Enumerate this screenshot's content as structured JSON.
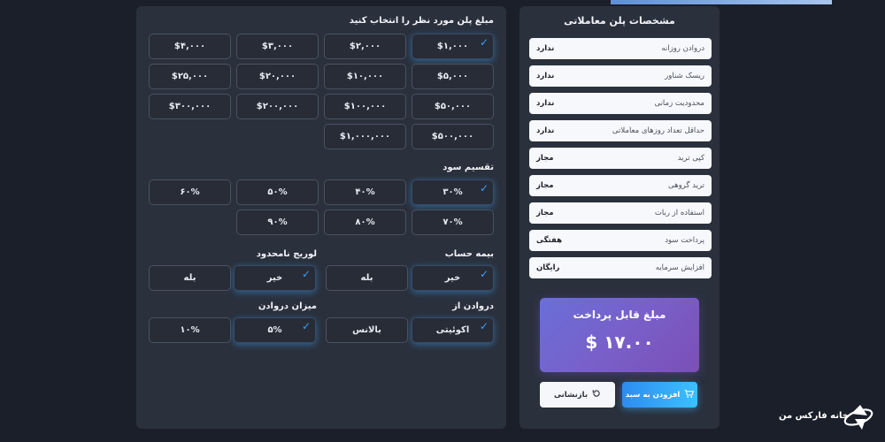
{
  "plan_amount": {
    "title": "مبلغ پلن مورد نظر را انتخاب کنید",
    "options": [
      "$۱,۰۰۰",
      "$۲,۰۰۰",
      "$۳,۰۰۰",
      "$۴,۰۰۰",
      "$۵,۰۰۰",
      "$۱۰,۰۰۰",
      "$۲۰,۰۰۰",
      "$۲۵,۰۰۰",
      "$۵۰,۰۰۰",
      "$۱۰۰,۰۰۰",
      "$۲۰۰,۰۰۰",
      "$۳۰۰,۰۰۰",
      "$۵۰۰,۰۰۰",
      "$۱,۰۰۰,۰۰۰"
    ],
    "selected": "$۱,۰۰۰"
  },
  "profit_split": {
    "title": "تقسیم سود",
    "options": [
      "۳۰%",
      "۴۰%",
      "۵۰%",
      "۶۰%",
      "۷۰%",
      "۸۰%",
      "۹۰%"
    ],
    "selected": "۳۰%"
  },
  "account_insurance": {
    "title": "بیمه حساب",
    "options": [
      "خیر",
      "بله"
    ],
    "selected": "خیر"
  },
  "unlimited_leverage": {
    "title": "لوریج نامحدود",
    "options": [
      "خیر",
      "بله"
    ],
    "selected": "خیر"
  },
  "drawdown_from": {
    "title": "دروادن از",
    "options": [
      "اکوئیتی",
      "بالانس"
    ],
    "selected": "اکوئیتی"
  },
  "drawdown_amount": {
    "title": "میزان دروادن",
    "options": [
      "۵%",
      "۱۰%"
    ],
    "selected": "۵%"
  },
  "specs": {
    "title": "مشخصات پلن معاملاتی",
    "rows": [
      {
        "label": "دروادن روزانه",
        "value": "ندارد"
      },
      {
        "label": "ریسک شناور",
        "value": "ندارد"
      },
      {
        "label": "محدودیت زمانی",
        "value": "ندارد"
      },
      {
        "label": "حداقل تعداد روزهای معاملاتی",
        "value": "ندارد"
      },
      {
        "label": "کپی ترید",
        "value": "مجاز"
      },
      {
        "label": "ترید گروهی",
        "value": "مجاز"
      },
      {
        "label": "استفاده از ربات",
        "value": "مجاز"
      },
      {
        "label": "پرداخت سود",
        "value": "هفتگی"
      },
      {
        "label": "افزایش سرمایه",
        "value": "رایگان"
      }
    ]
  },
  "payment": {
    "title": "مبلغ قابل پرداخت",
    "amount": "$ ۱۷.۰۰"
  },
  "buttons": {
    "add_to_cart": "افزودن به سبد",
    "reset": "بازنشانی"
  },
  "brand": {
    "name": "خانه فارکس من"
  },
  "icons": {
    "cart": "cart-icon",
    "reset": "reset-icon",
    "check": "check-icon",
    "logo": "logo-icon"
  },
  "colors": {
    "accent": "#3aa0ff",
    "panel": "#2a303c",
    "background": "#1b1f2a"
  }
}
